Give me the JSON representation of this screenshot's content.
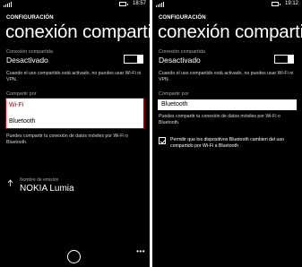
{
  "left": {
    "status": {
      "time": "18:57"
    },
    "header": {
      "label": "CONFIGURACIÓN",
      "title": "conexión compartida"
    },
    "sharing": {
      "label": "Conexión compartida",
      "value": "Desactivado",
      "note": "Cuando el uso compartido está activado, no puedes usar Wi-Fi ni VPN."
    },
    "share_over": {
      "label": "Compartir por",
      "options": [
        "Wi-Fi",
        "Bluetooth"
      ],
      "selected": "Wi-Fi",
      "note": "Puedes compartir tu conexión de datos móviles por Wi-Fi o Bluetooth."
    },
    "broadcast": {
      "label": "Nombre de emisión",
      "name": "NOKIA Lumia"
    },
    "appbar": {
      "ellipsis": "•••"
    }
  },
  "right": {
    "status": {
      "time": "19:12"
    },
    "header": {
      "label": "CONFIGURACIÓN",
      "title": "conexión compartida"
    },
    "sharing": {
      "label": "Conexión compartida",
      "value": "Desactivado",
      "note": "Cuando el uso compartido está activado, no puedes usar Wi-Fi ni VPN."
    },
    "share_over": {
      "label": "Compartir por",
      "selected": "Bluetooth",
      "note": "Puedes compartir tu conexión de datos móviles por Wi-Fi o Bluetooth."
    },
    "bluetooth_permission": {
      "checked": true,
      "text": "Permitir que los dispositivos Bluetooth cambien del uso compartido por Wi-Fi a Bluetooth"
    }
  },
  "colors": {
    "background": "#000000",
    "text": "#ffffff",
    "secondary_text": "#a6a6a6",
    "selected_option": "#c00000",
    "divider": "#ffffff"
  },
  "icons": [
    "signal-icon",
    "battery-icon",
    "device-icon",
    "compass-icon",
    "checkmark-icon"
  ]
}
